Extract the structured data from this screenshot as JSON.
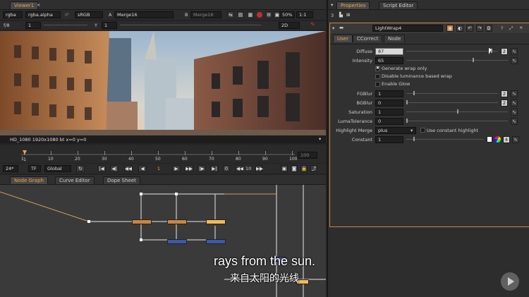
{
  "viewer": {
    "tab": "Viewer1",
    "close": "×",
    "channels": "rgba",
    "alpha": "rgba.alpha",
    "ip_label": "IP",
    "colorspace": "sRGB",
    "a_label": "A",
    "a_input": "Merge16",
    "b_label": "B",
    "b_input": "Merge16",
    "zoom": "50%",
    "ratio": "1:1",
    "fstop": "f/8",
    "gain": "1",
    "y_label": "Y",
    "gamma": "1",
    "mode": "2D",
    "format_text": "HD_1080 1920x1080  bt  x=0 y=0"
  },
  "timeline": {
    "marks": [
      "1",
      "10",
      "20",
      "30",
      "40",
      "50",
      "60",
      "70",
      "80",
      "90",
      "100"
    ],
    "current_left": "1",
    "end_frame": "100",
    "fps": "24*",
    "tf": "TF",
    "range": "Global",
    "current_frame": "1",
    "step": "10"
  },
  "graph_tabs": [
    {
      "label": "Node Graph",
      "active": true
    },
    {
      "label": "Curve Editor",
      "active": false
    },
    {
      "label": "Dope Sheet",
      "active": false
    }
  ],
  "panel_tabs": [
    {
      "label": "Properties",
      "active": true
    },
    {
      "label": "Script Editor",
      "active": false
    }
  ],
  "props": {
    "count": "3",
    "node_name": "LightWrap4",
    "subtabs": [
      "User",
      "CCorrect",
      "Node"
    ],
    "diffuse_label": "Diffuse",
    "diffuse": "87",
    "intensity_label": "Intensity",
    "intensity": "65",
    "gen_wrap": "Generate wrap only",
    "disable_lum": "Disable luminance based wrap",
    "enable_glow": "Enable Glow",
    "fgblur_label": "FGBlur",
    "fgblur": "1",
    "bgblur_label": "BGBlur",
    "bgblur": "0",
    "saturation_label": "Saturation",
    "saturation": "1",
    "lumatol_label": "LumaTolerance",
    "lumatol": "0",
    "highlight_label": "Highlight Merge",
    "highlight": "plus",
    "use_const": "Use constant highlight",
    "constant_label": "Constant",
    "constant": "1",
    "two": "2",
    "four": "4"
  },
  "subtitle": {
    "en": "rays from the sun.",
    "zh": "来自太阳的光线"
  },
  "colors": {
    "accent": "#f0a24a",
    "node_orange": "#c98545",
    "node_blue": "#3d58a8",
    "node_yellow": "#f3b95a"
  }
}
